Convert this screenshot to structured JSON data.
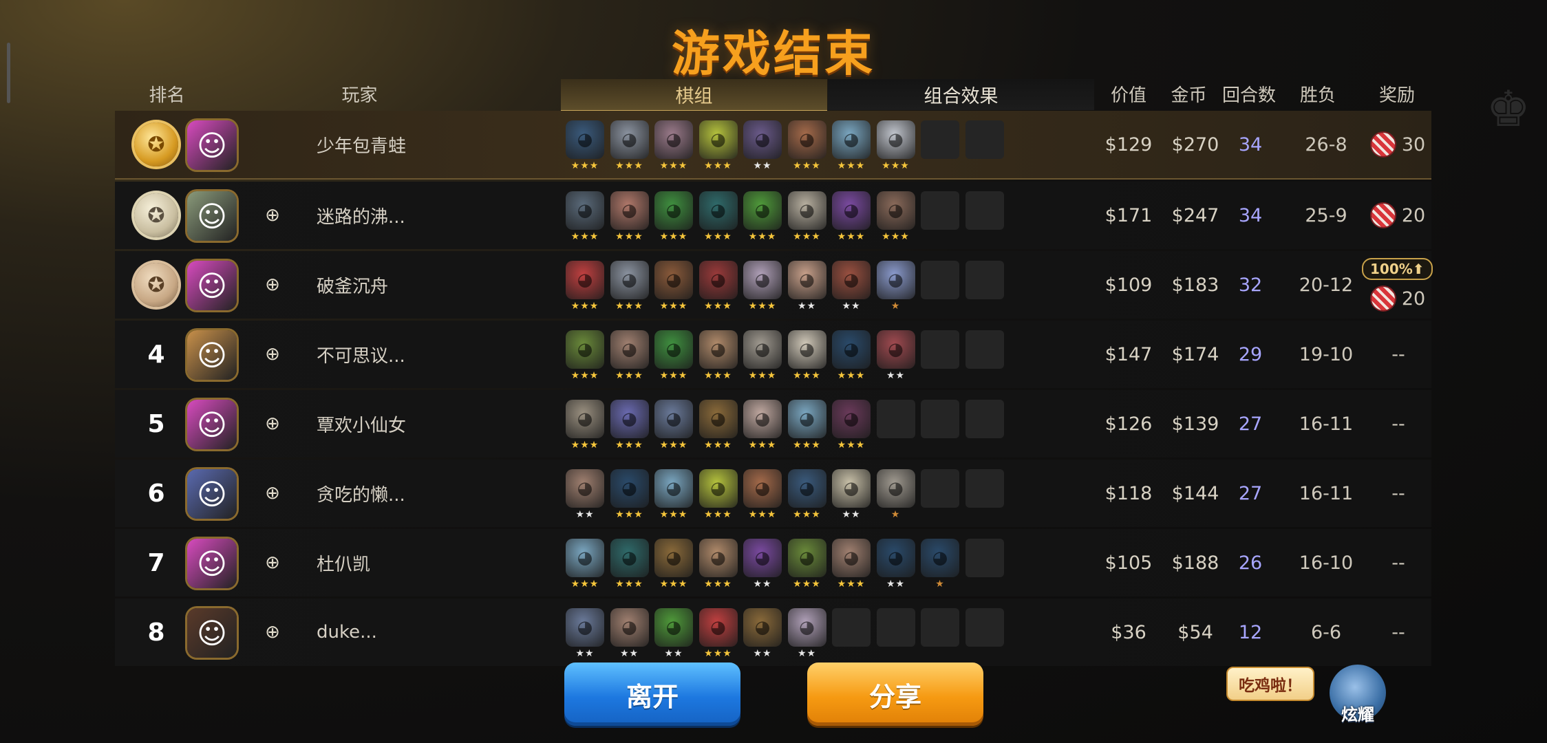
{
  "title": "游戏结束",
  "headers": {
    "rank": "排名",
    "player": "玩家",
    "tab_lineup": "棋组",
    "tab_synergy": "组合效果",
    "value": "价值",
    "gold": "金币",
    "rounds": "回合数",
    "winloss": "胜负",
    "reward": "奖励"
  },
  "rows": [
    {
      "rank": "",
      "medal": "gold",
      "avatar_color": "#d84bbf",
      "name": "少年包青蛙",
      "pieces": [
        [
          "#3a5a7c",
          "★★★"
        ],
        [
          "#8b93a0",
          "★★★"
        ],
        [
          "#9a7a8a",
          "★★★"
        ],
        [
          "#b5c23d",
          "★★★"
        ],
        [
          "#6a5a8a",
          "★★"
        ],
        [
          "#a46a4a",
          "★★★"
        ],
        [
          "#7aa6c0",
          "★★★"
        ],
        [
          "#c0c4cc",
          "★★★"
        ],
        [
          "",
          ""
        ],
        [
          "",
          ""
        ]
      ],
      "value": "$129",
      "gold": "$270",
      "rounds": "34",
      "winloss": "26-8",
      "reward": "30",
      "bonus": ""
    },
    {
      "rank": "",
      "medal": "silver",
      "avatar_color": "#8a9a7a",
      "name": "迷路的沸...",
      "pieces": [
        [
          "#5a6a7a",
          "★★★"
        ],
        [
          "#b0786a",
          "★★★"
        ],
        [
          "#3f8f3f",
          "★★★"
        ],
        [
          "#2f6a6a",
          "★★★"
        ],
        [
          "#4f9a3a",
          "★★★"
        ],
        [
          "#b8b0a0",
          "★★★"
        ],
        [
          "#7a4aa0",
          "★★★"
        ],
        [
          "#8a6a5a",
          "★★★"
        ],
        [
          "",
          ""
        ],
        [
          "",
          ""
        ]
      ],
      "value": "$171",
      "gold": "$247",
      "rounds": "34",
      "winloss": "25-9",
      "reward": "20",
      "bonus": ""
    },
    {
      "rank": "",
      "medal": "bronze",
      "avatar_color": "#d84bbf",
      "name": "破釜沉舟",
      "pieces": [
        [
          "#c04040",
          "★★★"
        ],
        [
          "#8b93a0",
          "★★★"
        ],
        [
          "#8a5a3a",
          "★★★"
        ],
        [
          "#9a3a3a",
          "★★★"
        ],
        [
          "#b0a0b8",
          "★★★"
        ],
        [
          "#c8a08a",
          "★★"
        ],
        [
          "#9a5040",
          "★★"
        ],
        [
          "#8a9acc",
          "★"
        ],
        [
          "",
          ""
        ],
        [
          "",
          ""
        ]
      ],
      "value": "$109",
      "gold": "$183",
      "rounds": "32",
      "winloss": "20-12",
      "reward": "20",
      "bonus": "100%⬆"
    },
    {
      "rank": "4",
      "medal": "",
      "avatar_color": "#c8904a",
      "name": "不可思议...",
      "pieces": [
        [
          "#6a8a3a",
          "★★★"
        ],
        [
          "#a08070",
          "★★★"
        ],
        [
          "#3f8f3f",
          "★★★"
        ],
        [
          "#b08a6a",
          "★★★"
        ],
        [
          "#a09a90",
          "★★★"
        ],
        [
          "#d0c8b8",
          "★★★"
        ],
        [
          "#2a4a6a",
          "★★★"
        ],
        [
          "#a04a50",
          "★★"
        ],
        [
          "",
          ""
        ],
        [
          "",
          ""
        ]
      ],
      "value": "$147",
      "gold": "$174",
      "rounds": "29",
      "winloss": "19-10",
      "reward": "--",
      "bonus": ""
    },
    {
      "rank": "5",
      "medal": "",
      "avatar_color": "#d84bbf",
      "name": "覃欢小仙女",
      "pieces": [
        [
          "#9a9080",
          "★★★"
        ],
        [
          "#6a6ab0",
          "★★★"
        ],
        [
          "#6a7a9a",
          "★★★"
        ],
        [
          "#8a6a3a",
          "★★★"
        ],
        [
          "#c0a8a0",
          "★★★"
        ],
        [
          "#7aa6c0",
          "★★★"
        ],
        [
          "#6a3a5a",
          "★★★"
        ],
        [
          "",
          ""
        ],
        [
          "",
          ""
        ],
        [
          "",
          ""
        ]
      ],
      "value": "$126",
      "gold": "$139",
      "rounds": "27",
      "winloss": "16-11",
      "reward": "--",
      "bonus": ""
    },
    {
      "rank": "6",
      "medal": "",
      "avatar_color": "#5a6ab0",
      "name": "贪吃的懒...",
      "pieces": [
        [
          "#a08070",
          "★★"
        ],
        [
          "#2a4a6a",
          "★★★"
        ],
        [
          "#7aa6c0",
          "★★★"
        ],
        [
          "#b5c23d",
          "★★★"
        ],
        [
          "#a46a4a",
          "★★★"
        ],
        [
          "#3a5a7c",
          "★★★"
        ],
        [
          "#c8c0a8",
          "★★"
        ],
        [
          "#a09a90",
          "★"
        ],
        [
          "",
          ""
        ],
        [
          "",
          ""
        ]
      ],
      "value": "$118",
      "gold": "$144",
      "rounds": "27",
      "winloss": "16-11",
      "reward": "--",
      "bonus": ""
    },
    {
      "rank": "7",
      "medal": "",
      "avatar_color": "#d84bbf",
      "name": "杜仈凯",
      "pieces": [
        [
          "#7aa6c0",
          "★★★"
        ],
        [
          "#2f6a6a",
          "★★★"
        ],
        [
          "#8a6a3a",
          "★★★"
        ],
        [
          "#b08a6a",
          "★★★"
        ],
        [
          "#7a4aa0",
          "★★"
        ],
        [
          "#6a8a3a",
          "★★★"
        ],
        [
          "#a08070",
          "★★★"
        ],
        [
          "#2a4a6a",
          "★★"
        ],
        [
          "#2a4a6a",
          "★"
        ],
        [
          "",
          ""
        ]
      ],
      "value": "$105",
      "gold": "$188",
      "rounds": "26",
      "winloss": "16-10",
      "reward": "--",
      "bonus": ""
    },
    {
      "rank": "8",
      "medal": "",
      "avatar_color": "#5a3a2a",
      "name": "duke...",
      "pieces": [
        [
          "#6a7a9a",
          "★★"
        ],
        [
          "#a08070",
          "★★"
        ],
        [
          "#4f9a3a",
          "★★"
        ],
        [
          "#c04040",
          "★★★"
        ],
        [
          "#8a6a3a",
          "★★"
        ],
        [
          "#b0a0b8",
          "★★"
        ],
        [
          "",
          ""
        ],
        [
          "",
          ""
        ],
        [
          "",
          ""
        ],
        [
          "",
          ""
        ]
      ],
      "value": "$36",
      "gold": "$54",
      "rounds": "12",
      "winloss": "6-6",
      "reward": "--",
      "bonus": ""
    }
  ],
  "buttons": {
    "leave": "离开",
    "share": "分享"
  },
  "bubble": "吃鸡啦！",
  "mascot_label": "炫耀",
  "icons": {
    "add_friend": "add-friend-icon",
    "reward": "candy-icon",
    "crown": "crown-icon"
  },
  "colors": {
    "title": "#f7a01e",
    "rounds": "#a8a6ff",
    "leave_btn": "#1d78e0",
    "share_btn": "#f69a12"
  }
}
